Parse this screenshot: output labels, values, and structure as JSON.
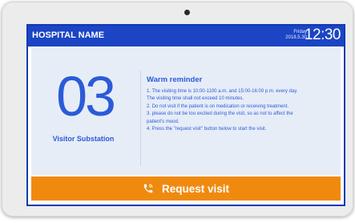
{
  "header": {
    "hospital_name": "HOSPITAL NAME",
    "weekday": "Friday",
    "date": "2018.5.30",
    "time": "12:30"
  },
  "queue": {
    "number": "03",
    "label": "Visitor Substation"
  },
  "reminder": {
    "title": "Warm reminder",
    "lines": [
      "1. The visiting time is 10:00-1100 a.m. and 15:00-16:00 p.m. every day.",
      "The visiting time shall not exceed 10 minutes.",
      "2. Do not visit if the patient is on medication or receiving treatment.",
      "3. please do not be too excited during the visit, so as not to affect the",
      "patient's mood.",
      "4. Press the \"request visit\" button below to start the visit."
    ]
  },
  "action": {
    "request_label": "Request visit",
    "icon": "phone-icon"
  },
  "colors": {
    "header_blue": "#1b45c4",
    "text_blue": "#2b5bd7",
    "panel_bg": "#e7edf7",
    "button_orange": "#f08a0f"
  }
}
